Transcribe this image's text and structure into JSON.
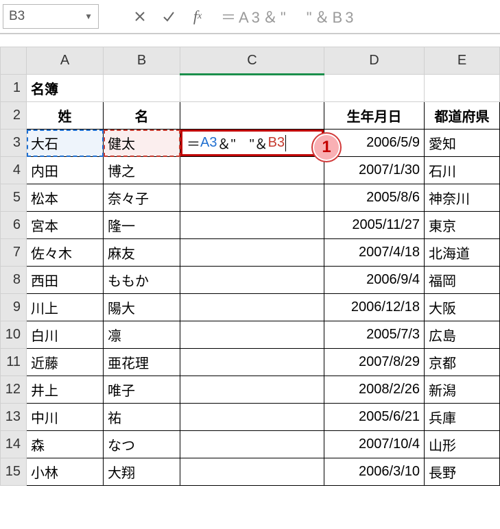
{
  "formulaBar": {
    "nameBox": "B3",
    "formulaGrey": "＝A3＆\"　\"＆B3"
  },
  "colHeaders": [
    "A",
    "B",
    "C",
    "D",
    "E"
  ],
  "titleCell": "名簿",
  "headers": {
    "A": "姓",
    "B": "名",
    "C": "",
    "D": "生年月日",
    "E": "都道府県"
  },
  "activeCell": {
    "eq": "＝",
    "ref1": "A3",
    "amp1": "＆\"　\"＆",
    "ref2": "B3"
  },
  "rows": [
    {
      "n": 3,
      "A": "大石",
      "B": "健太",
      "D": "2006/5/9",
      "E": "愛知"
    },
    {
      "n": 4,
      "A": "内田",
      "B": "博之",
      "D": "2007/1/30",
      "E": "石川"
    },
    {
      "n": 5,
      "A": "松本",
      "B": "奈々子",
      "D": "2005/8/6",
      "E": "神奈川"
    },
    {
      "n": 6,
      "A": "宮本",
      "B": "隆一",
      "D": "2005/11/27",
      "E": "東京"
    },
    {
      "n": 7,
      "A": "佐々木",
      "B": "麻友",
      "D": "2007/4/18",
      "E": "北海道"
    },
    {
      "n": 8,
      "A": "西田",
      "B": "ももか",
      "D": "2006/9/4",
      "E": "福岡"
    },
    {
      "n": 9,
      "A": "川上",
      "B": "陽大",
      "D": "2006/12/18",
      "E": "大阪"
    },
    {
      "n": 10,
      "A": "白川",
      "B": "凛",
      "D": "2005/7/3",
      "E": "広島"
    },
    {
      "n": 11,
      "A": "近藤",
      "B": "亜花理",
      "D": "2007/8/29",
      "E": "京都"
    },
    {
      "n": 12,
      "A": "井上",
      "B": "唯子",
      "D": "2008/2/26",
      "E": "新潟"
    },
    {
      "n": 13,
      "A": "中川",
      "B": "祐",
      "D": "2005/6/21",
      "E": "兵庫"
    },
    {
      "n": 14,
      "A": "森",
      "B": "なつ",
      "D": "2007/10/4",
      "E": "山形"
    },
    {
      "n": 15,
      "A": "小林",
      "B": "大翔",
      "D": "2006/3/10",
      "E": "長野"
    }
  ],
  "rowHeaders": [
    "1",
    "2",
    "3",
    "4",
    "5",
    "6",
    "7",
    "8",
    "9",
    "10",
    "11",
    "12",
    "13",
    "14",
    "15"
  ],
  "badge": "1",
  "chart_data": {
    "type": "table",
    "title": "名簿",
    "columns": [
      "姓",
      "名",
      "生年月日",
      "都道府県"
    ],
    "rows": [
      [
        "大石",
        "健太",
        "2006/5/9",
        "愛知"
      ],
      [
        "内田",
        "博之",
        "2007/1/30",
        "石川"
      ],
      [
        "松本",
        "奈々子",
        "2005/8/6",
        "神奈川"
      ],
      [
        "宮本",
        "隆一",
        "2005/11/27",
        "東京"
      ],
      [
        "佐々木",
        "麻友",
        "2007/4/18",
        "北海道"
      ],
      [
        "西田",
        "ももか",
        "2006/9/4",
        "福岡"
      ],
      [
        "川上",
        "陽大",
        "2006/12/18",
        "大阪"
      ],
      [
        "白川",
        "凛",
        "2005/7/3",
        "広島"
      ],
      [
        "近藤",
        "亜花理",
        "2007/8/29",
        "京都"
      ],
      [
        "井上",
        "唯子",
        "2008/2/26",
        "新潟"
      ],
      [
        "中川",
        "祐",
        "2005/6/21",
        "兵庫"
      ],
      [
        "森",
        "なつ",
        "2007/10/4",
        "山形"
      ],
      [
        "小林",
        "大翔",
        "2006/3/10",
        "長野"
      ]
    ]
  }
}
